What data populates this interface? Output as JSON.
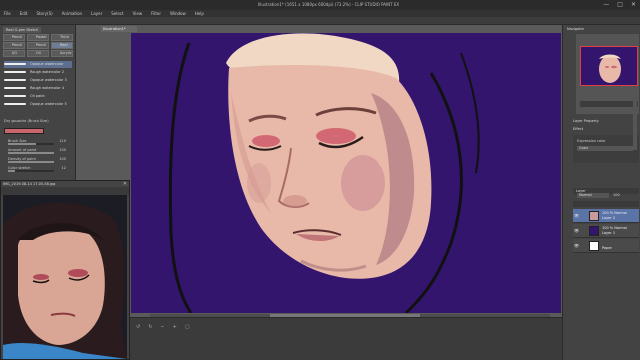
{
  "window": {
    "title": "Illustration1* (1651 x 1080px 600dpi) (73.2%) - CLIP STUDIO PAINT EX",
    "minimize": "—",
    "maximize": "□",
    "close": "✕"
  },
  "menu": [
    "File",
    "Edit",
    "Story(S)",
    "Animation",
    "Layer",
    "Select",
    "View",
    "Filter",
    "Window",
    "Help"
  ],
  "left_panel": {
    "tab": "Real G-pen Sketch",
    "tools": [
      "Pencil",
      "Pastel",
      "Thick",
      "Pencil",
      "Pencil",
      "Real",
      "I/O",
      "Oil",
      "Acrylic"
    ],
    "brushes": [
      "Opaque watercolor",
      "Rough watercolor 2",
      "Opaque watercolor 3",
      "Rough watercolor 4",
      "Oil paint",
      "Opaque watercolor 5"
    ],
    "selected_brush_index": 0,
    "properties_title": "Dry gouache (Brush Size)",
    "properties": [
      {
        "label": "Brush Size",
        "value": "110",
        "fill": 0.6
      },
      {
        "label": "Amount of paint",
        "value": "100",
        "fill": 1.0
      },
      {
        "label": "Density of paint",
        "value": "100",
        "fill": 1.0
      },
      {
        "label": "Color stretch",
        "value": "12",
        "fill": 0.15
      }
    ],
    "color": "#c9666c"
  },
  "document_tab": "Illustration1*",
  "reference_window": {
    "title": "IMG_2019-08-14 17-05-58.jpg",
    "close": "✕"
  },
  "right_panel": {
    "navigator_tab": "Navigator",
    "effect_title": "Layer Property",
    "effect_section": "Effect",
    "effect_label": "Expression color",
    "effect_value": "Color",
    "layer_tab": "Layer",
    "blend_mode": "Normal",
    "opacity": "100",
    "layers": [
      {
        "mode": "100 % Normal",
        "name": "Layer 2",
        "thumb": "#c99a9a",
        "selected": true
      },
      {
        "mode": "100 % Normal",
        "name": "Layer 1",
        "thumb": "#34156e",
        "selected": false
      },
      {
        "mode": "",
        "name": "Paper",
        "thumb": "#ffffff",
        "selected": false
      }
    ]
  },
  "colors": {
    "canvas_bg": "#34156e",
    "skin": "#e8b9a8",
    "hair": "#f0d8c4",
    "accent": "#5b74a8"
  }
}
